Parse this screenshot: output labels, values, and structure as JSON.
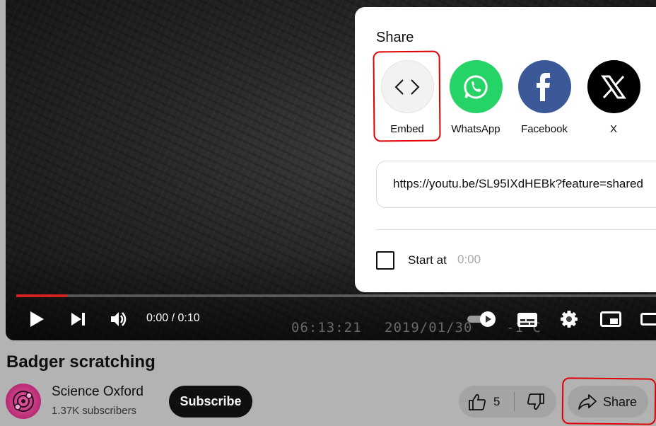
{
  "player": {
    "time_display": "0:00 / 0:10",
    "overlay_time": "06:13:21",
    "overlay_date": "2019/01/30",
    "overlay_temp": "-1°C",
    "progress_fraction": 0.08
  },
  "share_dialog": {
    "title": "Share",
    "targets": [
      {
        "label": "Embed",
        "icon": "embed-code-icon",
        "color": "#f2f2f2"
      },
      {
        "label": "WhatsApp",
        "icon": "whatsapp-icon",
        "color": "#25d366"
      },
      {
        "label": "Facebook",
        "icon": "facebook-icon",
        "color": "#3b5998"
      },
      {
        "label": "X",
        "icon": "x-icon",
        "color": "#000000"
      }
    ],
    "url": "https://youtu.be/SL95IXdHEBk?feature=shared",
    "start_at_label": "Start at",
    "start_at_time": "0:00"
  },
  "video": {
    "title": "Badger scratching",
    "channel": "Science Oxford",
    "subscribers": "1.37K subscribers",
    "subscribe_label": "Subscribe",
    "like_count": "5",
    "share_label": "Share"
  },
  "colors": {
    "progress": "#d62020",
    "annotation": "#e00000",
    "page_dim": "#b3b3b3"
  }
}
